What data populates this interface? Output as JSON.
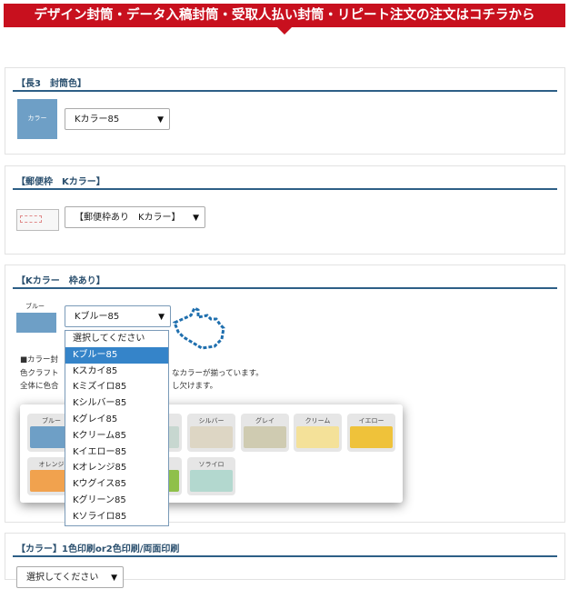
{
  "banner": {
    "text": "デザイン封筒・データ入稿封筒・受取人払い封筒・リピート注文の注文はコチラから"
  },
  "section1": {
    "title": "【長3　封筒色】",
    "swatch_label": "カラー",
    "select_value": "Kカラー85"
  },
  "section2": {
    "title": "【郵便枠　Kカラー】",
    "select_value": "【郵便枠あり　Kカラー】"
  },
  "section3": {
    "title": "【Kカラー　枠あり】",
    "swatch_label": "ブルー",
    "select_value": "Kブルー85",
    "desc_lines": [
      "■カラー封",
      "色クラフト",
      "全体に色合"
    ],
    "desc_right_lines": [
      "なカラーが揃っています。",
      "し欠けます。"
    ],
    "palette": [
      {
        "label": "ブルー",
        "color": "#6e9fc6"
      },
      {
        "label": "",
        "color": "#a8c4d6"
      },
      {
        "label": "",
        "color": "#c7d7d0"
      },
      {
        "label": "シルバー",
        "color": "#ddd6c4"
      },
      {
        "label": "グレイ",
        "color": "#cfcbb1"
      },
      {
        "label": "クリーム",
        "color": "#f4e199"
      },
      {
        "label": "イエロー",
        "color": "#efc23a"
      },
      {
        "label": "オレンジ",
        "color": "#f1a24e"
      },
      {
        "label": "",
        "color": "#c8d9a6"
      },
      {
        "label": "",
        "color": "#8fc04a"
      },
      {
        "label": "ソライロ",
        "color": "#b3d8cf"
      }
    ],
    "dropdown_options": [
      "選択してください",
      "Kブルー85",
      "Kスカイ85",
      "Kミズイロ85",
      "Kシルバー85",
      "Kグレイ85",
      "Kクリーム85",
      "Kイエロー85",
      "Kオレンジ85",
      "Kウグイス85",
      "Kグリーン85",
      "Kソライロ85"
    ],
    "dropdown_selected_index": 1
  },
  "section4": {
    "title": "【カラー】1色印刷or2色印刷/両面印刷",
    "select_value": "選択してください"
  },
  "colors": {
    "banner": "#c8101e",
    "rule": "#2d5f86",
    "title": "#2a4f6e",
    "highlight": "#3584c9"
  },
  "icons": {
    "cursor": "pointing-hand-cursor-icon",
    "select_arrow": "▼"
  }
}
